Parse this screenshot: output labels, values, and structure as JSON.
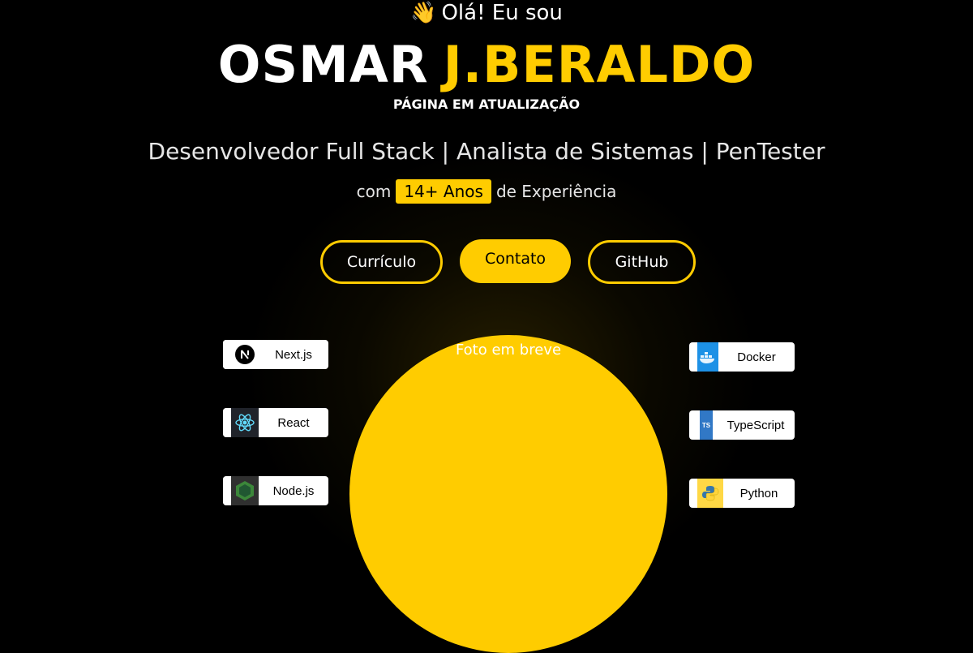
{
  "hero": {
    "greeting_emoji": "👋",
    "greeting": "Olá! Eu sou",
    "first_name": "OSMAR",
    "last_name": "J.BERALDO",
    "status": "PÁGINA EM ATUALIZAÇÃO",
    "roles": "Desenvolvedor Full Stack | Analista de Sistemas | PenTester",
    "experience_prefix": "com",
    "experience_badge": "14+ Anos",
    "experience_suffix": "de Experiência"
  },
  "buttons": {
    "resume": "Currículo",
    "contact": "Contato",
    "github": "GitHub"
  },
  "photo": {
    "placeholder": "Foto em breve"
  },
  "tech_left": [
    {
      "label": "Next.js",
      "icon": "nextjs-icon"
    },
    {
      "label": "React",
      "icon": "react-icon"
    },
    {
      "label": "Node.js",
      "icon": "nodejs-icon"
    }
  ],
  "tech_right": [
    {
      "label": "Docker",
      "icon": "docker-icon"
    },
    {
      "label": "TypeScript",
      "icon": "typescript-icon"
    },
    {
      "label": "Python",
      "icon": "python-icon"
    }
  ],
  "colors": {
    "accent": "#ffcc00",
    "background": "#000000",
    "text": "#ffffff"
  }
}
